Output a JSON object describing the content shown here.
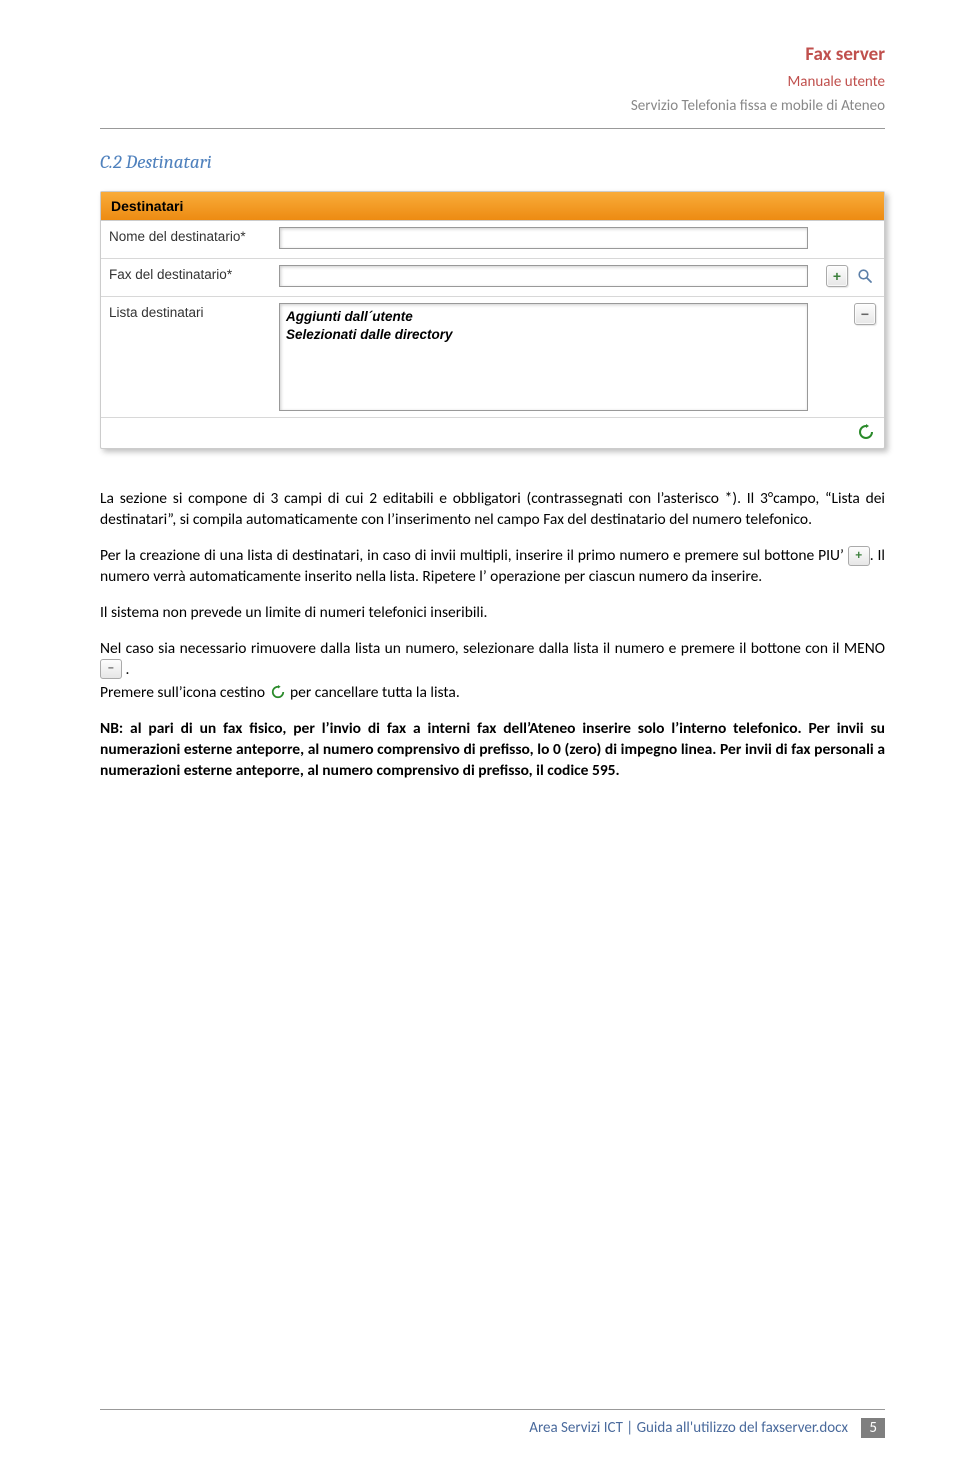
{
  "header": {
    "title": "Fax server",
    "subtitle1": "Manuale utente",
    "subtitle2": "Servizio Telefonia fissa e mobile di Ateneo"
  },
  "section_title": "C.2 Destinatari",
  "form": {
    "panel_title": "Destinatari",
    "row1_label": "Nome del destinatario*",
    "row2_label": "Fax del destinatario*",
    "row3_label": "Lista destinatari",
    "list_content": "Aggiunti dall´utente\nSelezionati dalle directory"
  },
  "paragraphs": {
    "p1": "La sezione si compone di 3 campi di cui 2 editabili e obbligatori (contrassegnati con l’asterisco *). Il 3°campo, “Lista dei destinatari”, si compila automaticamente con l’inserimento nel campo Fax del destinatario del numero telefonico.",
    "p2a": "Per la creazione di una lista di destinatari, in caso di invii multipli, inserire il primo numero e premere sul bottone PIU’ ",
    "p2b": ". Il numero verrà automaticamente inserito nella lista. Ripetere l’ operazione per ciascun numero da inserire.",
    "p3": "Il sistema non prevede un limite di numeri telefonici inseribili.",
    "p4a": "Nel caso sia necessario rimuovere dalla lista un numero, selezionare dalla lista il numero e premere il bottone con il MENO ",
    "p4b": " .",
    "p5a": "Premere sull’icona cestino ",
    "p5b": " per cancellare tutta la lista.",
    "p6": "NB: al pari di un fax fisico, per l’invio di fax a interni fax dell’Ateneo inserire solo l’interno telefonico. Per invii su numerazioni esterne anteporre, al numero comprensivo di prefisso, lo 0 (zero) di impegno linea. Per invii di fax personali a numerazioni esterne anteporre, al numero comprensivo di prefisso, il codice 595."
  },
  "footer": {
    "text": "Area Servizi ICT | Guida all'utilizzo del faxserver.docx",
    "page": "5"
  }
}
